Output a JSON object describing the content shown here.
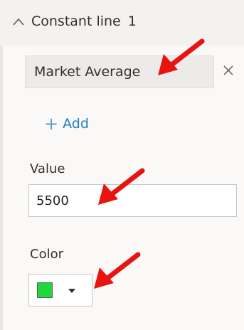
{
  "section": {
    "title": "Constant line",
    "count": "1",
    "expanded": true,
    "icon": "chevron-up-icon"
  },
  "line_item": {
    "name": "Market Average",
    "remove_icon": "close-icon"
  },
  "add_button": {
    "label": "Add",
    "icon": "plus-icon"
  },
  "value_field": {
    "label": "Value",
    "value": "5500"
  },
  "color_field": {
    "label": "Color",
    "selected_color": "#21d83b",
    "icon": "caret-down-icon"
  },
  "annotations": {
    "arrow_color": "#e8140f"
  }
}
